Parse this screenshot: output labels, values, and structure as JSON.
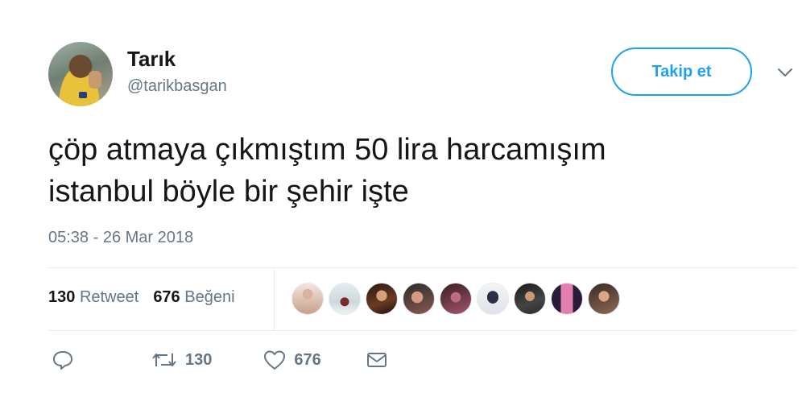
{
  "author": {
    "display_name": "Tarık",
    "handle": "@tarikbasgan"
  },
  "header": {
    "follow_label": "Takip et",
    "menu_icon": "chevron-down-icon"
  },
  "tweet": {
    "text_lines": [
      "çöp atmaya çıkmıştım 50 lira harcamışım",
      "istanbul böyle bir şehir işte"
    ],
    "timestamp": "05:38 - 26 Mar 2018"
  },
  "stats": {
    "retweet_count": "130",
    "retweet_label": "Retweet",
    "like_count": "676",
    "like_label": "Beğeni",
    "liker_avatar_count": 9
  },
  "actions": {
    "reply_icon": "reply-icon",
    "retweet_icon": "retweet-icon",
    "retweet_count": "130",
    "like_icon": "heart-icon",
    "like_count": "676",
    "dm_icon": "envelope-icon"
  },
  "colors": {
    "accent": "#1da1f2",
    "text": "#14171a",
    "secondary": "#657786",
    "divider": "#e6ecf0"
  }
}
